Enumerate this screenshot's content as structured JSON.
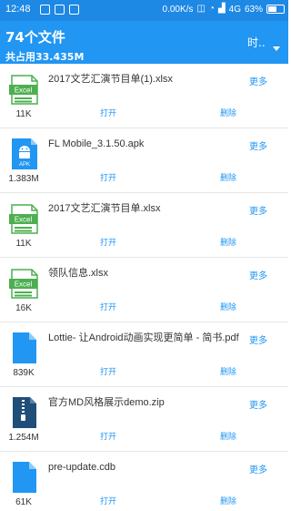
{
  "status_bar": {
    "time": "12:48",
    "speed": "0.00K/s",
    "network": "4G",
    "battery": "63%",
    "battery_level": 0.63
  },
  "toolbar": {
    "title": "74个文件",
    "subtitle": "共占用33.435M",
    "sort_label": "时.."
  },
  "actions": {
    "more": "更多",
    "open": "打开",
    "delete": "删除"
  },
  "files": [
    {
      "name": "2017文艺汇演节目单(1).xlsx",
      "size": "11K",
      "type": "excel",
      "icon_label": "Excel"
    },
    {
      "name": "FL Mobile_3.1.50.apk",
      "size": "1.383M",
      "type": "apk",
      "icon_label": "APK"
    },
    {
      "name": "2017文艺汇演节目单.xlsx",
      "size": "11K",
      "type": "excel",
      "icon_label": "Excel"
    },
    {
      "name": "领队信息.xlsx",
      "size": "16K",
      "type": "excel",
      "icon_label": "Excel"
    },
    {
      "name": "Lottie- 让Android动画实现更简单 - 简书.pdf",
      "size": "839K",
      "type": "doc",
      "icon_label": ""
    },
    {
      "name": "官方MD风格展示demo.zip",
      "size": "1.254M",
      "type": "zip",
      "icon_label": ""
    },
    {
      "name": "pre-update.cdb",
      "size": "61K",
      "type": "doc",
      "icon_label": ""
    }
  ],
  "colors": {
    "status_bar": "#1e88e5",
    "toolbar": "#2196f3",
    "excel_green": "#4caf50",
    "file_blue": "#2196f3",
    "zip_navy": "#1f4e79"
  }
}
